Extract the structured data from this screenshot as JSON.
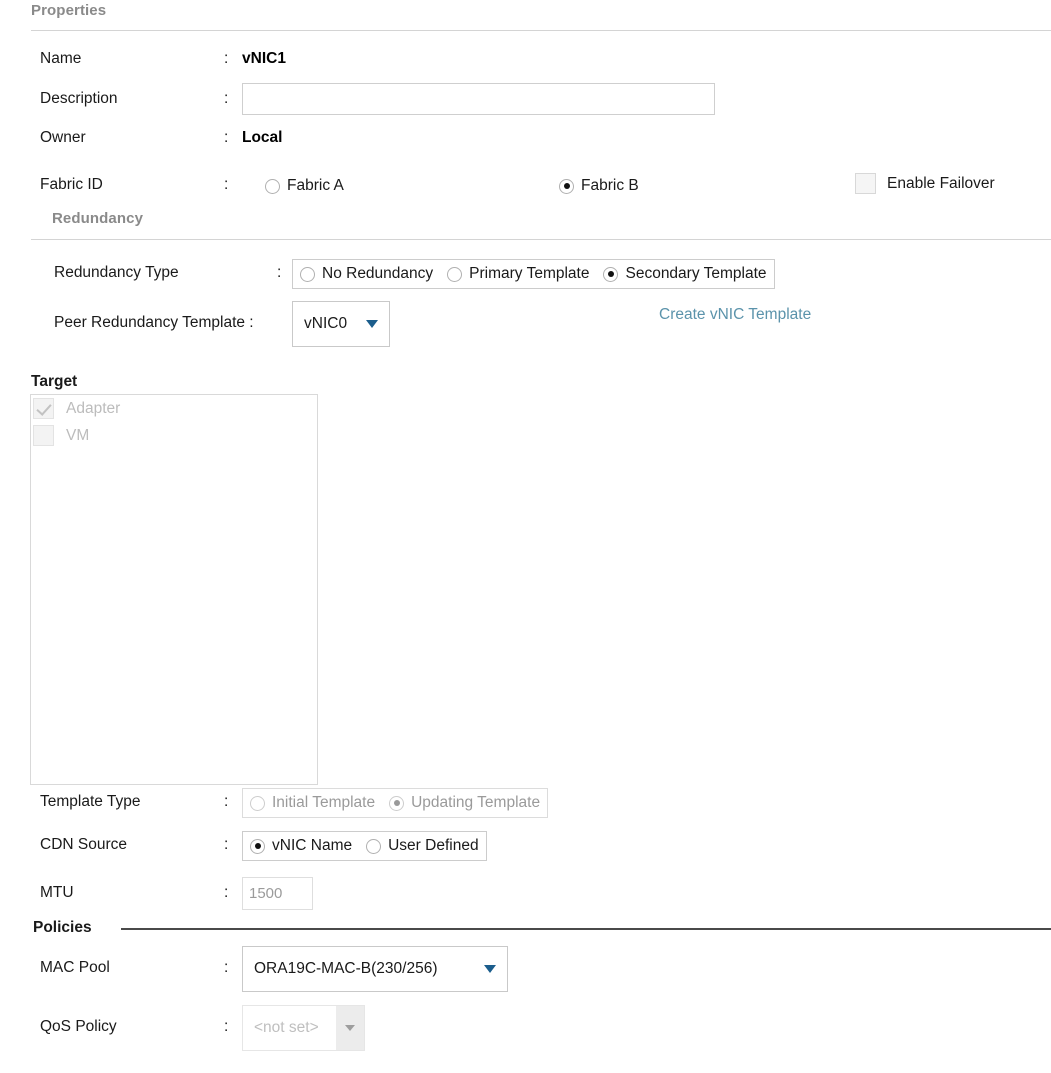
{
  "sections": {
    "properties": {
      "title": "Properties"
    },
    "redundancy": {
      "title": "Redundancy"
    },
    "target": {
      "title": "Target"
    },
    "policies": {
      "title": "Policies"
    }
  },
  "colon": ":",
  "properties": {
    "name": {
      "label": "Name",
      "value": "vNIC1"
    },
    "description": {
      "label": "Description",
      "value": "",
      "placeholder": ""
    },
    "owner": {
      "label": "Owner",
      "value": "Local"
    },
    "fabric_id": {
      "label": "Fabric ID",
      "options": [
        {
          "label": "Fabric A",
          "selected": false
        },
        {
          "label": "Fabric B",
          "selected": true
        }
      ],
      "fabric_a": "Fabric A",
      "fabric_b": "Fabric B"
    },
    "enable_failover": {
      "label": "Enable Failover",
      "checked": false
    }
  },
  "redundancy": {
    "redundancy_type": {
      "label": "Redundancy Type",
      "no_redundancy": "No Redundancy",
      "primary_template": "Primary Template",
      "secondary_template": "Secondary Template",
      "selected": "Secondary Template"
    },
    "peer_redundancy_template": {
      "label": "Peer Redundancy Template :",
      "value": "vNIC0"
    },
    "create_link": "Create vNIC Template"
  },
  "target": {
    "items": [
      {
        "label": "Adapter",
        "checked": true,
        "disabled": true
      },
      {
        "label": "VM",
        "checked": false,
        "disabled": true
      }
    ]
  },
  "template_type": {
    "label": "Template Type",
    "initial": "Initial Template",
    "updating": "Updating Template",
    "selected": "Updating Template",
    "disabled": true
  },
  "cdn_source": {
    "label": "CDN Source",
    "vnic_name": "vNIC Name",
    "user_defined": "User Defined",
    "selected": "vNIC Name"
  },
  "mtu": {
    "label": "MTU",
    "value": "1500",
    "disabled": true
  },
  "policies": {
    "mac_pool": {
      "label": "MAC Pool",
      "value": "ORA19C-MAC-B(230/256)"
    },
    "qos_policy": {
      "label": "QoS Policy",
      "value": "<not set>",
      "disabled": true
    }
  },
  "colors": {
    "link": "#5b93ab",
    "dropdown_arrow": "#1b5d8c",
    "section_gray": "#8a8a8a",
    "text": "#1a1a1a",
    "disabled_text": "#bfbfbf"
  }
}
